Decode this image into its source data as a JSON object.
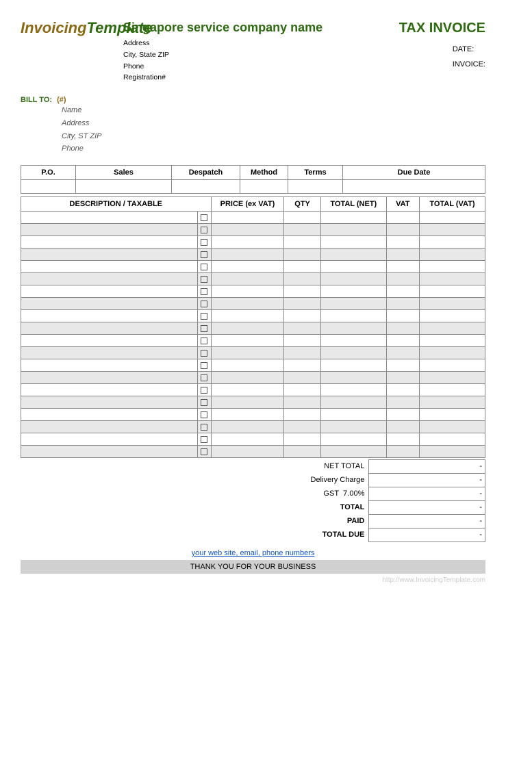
{
  "header": {
    "logo": {
      "part1": "Invoicing",
      "part2": "Template"
    },
    "company": {
      "name": "Singapore service company name",
      "address": "Address",
      "city_state_zip": "City, State ZIP",
      "phone": "Phone",
      "registration": "Registration#"
    },
    "invoice": {
      "title": "TAX INVOICE",
      "date_label": "DATE:",
      "date_value": "",
      "invoice_label": "INVOICE:",
      "invoice_value": ""
    }
  },
  "bill_to": {
    "label": "BILL TO:",
    "hash": "(#)",
    "name": "Name",
    "address": "Address",
    "city_st_zip": "City, ST ZIP",
    "phone": "Phone"
  },
  "po_table": {
    "headers": [
      "P.O.",
      "Sales",
      "Despatch",
      "Method",
      "Terms",
      "Due Date"
    ]
  },
  "items_table": {
    "headers": [
      "DESCRIPTION / TAXABLE",
      "",
      "PRICE (ex VAT)",
      "QTY",
      "TOTAL (NET)",
      "VAT",
      "TOTAL (VAT)"
    ],
    "rows": 20
  },
  "totals": {
    "net_total_label": "NET TOTAL",
    "net_total_value": "-",
    "delivery_charge_label": "Delivery Charge",
    "delivery_charge_value": "-",
    "gst_label": "GST",
    "gst_rate": "7.00%",
    "gst_value": "-",
    "total_label": "TOTAL",
    "total_value": "-",
    "paid_label": "PAID",
    "paid_value": "-",
    "total_due_label": "TOTAL DUE",
    "total_due_value": "-"
  },
  "footer": {
    "link_text": "your web site, email, phone numbers",
    "thank_you": "THANK YOU FOR YOUR BUSINESS",
    "watermark": "http://www.InvoicingTemplate.com"
  }
}
